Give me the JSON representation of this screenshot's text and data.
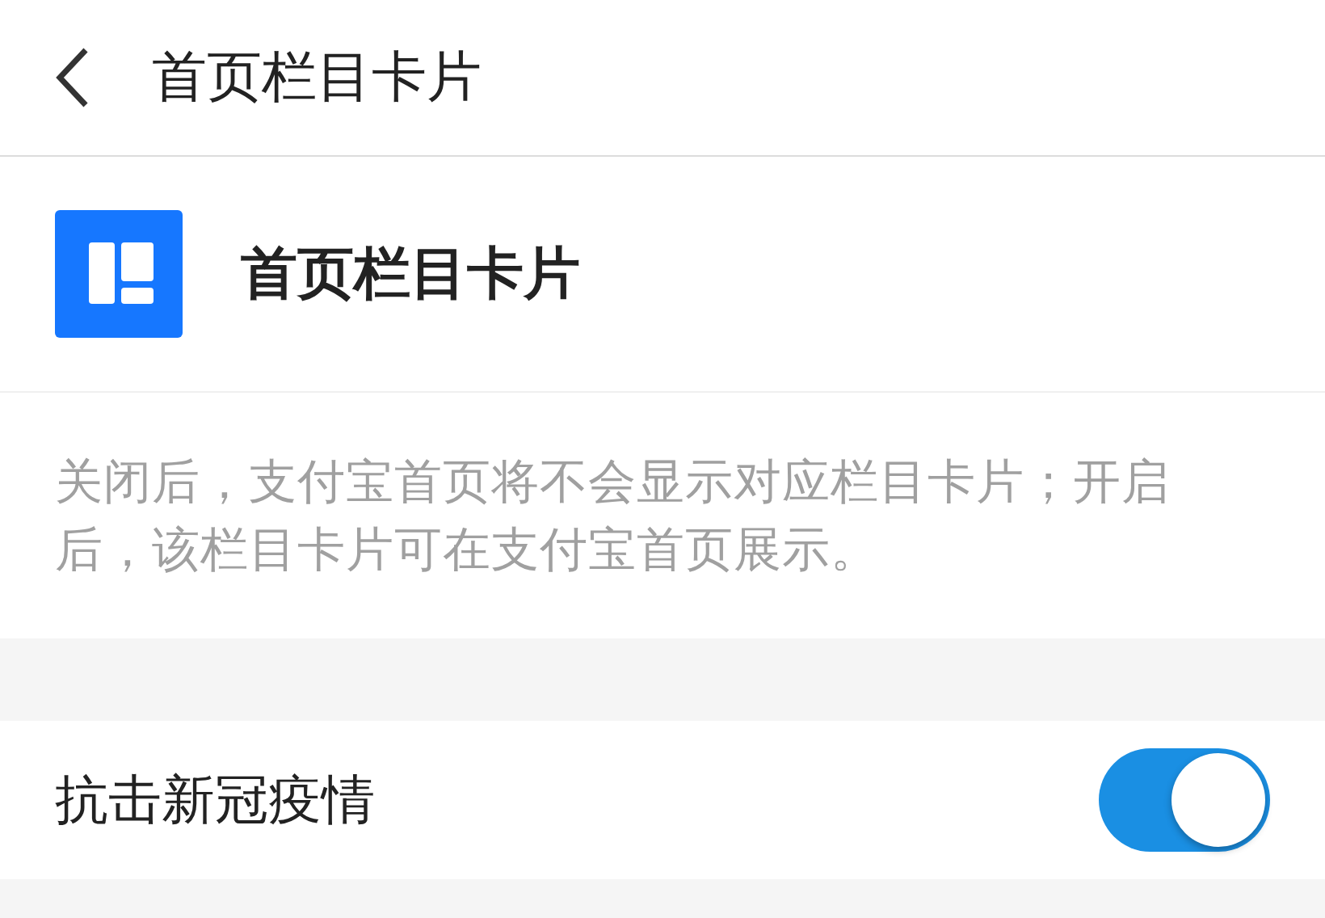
{
  "header": {
    "title": "首页栏目卡片"
  },
  "card": {
    "title": "首页栏目卡片",
    "description": "关闭后，支付宝首页将不会显示对应栏目卡片；开启后，该栏目卡片可在支付宝首页展示。"
  },
  "settings": [
    {
      "label": "抗击新冠疫情",
      "on": true
    }
  ]
}
